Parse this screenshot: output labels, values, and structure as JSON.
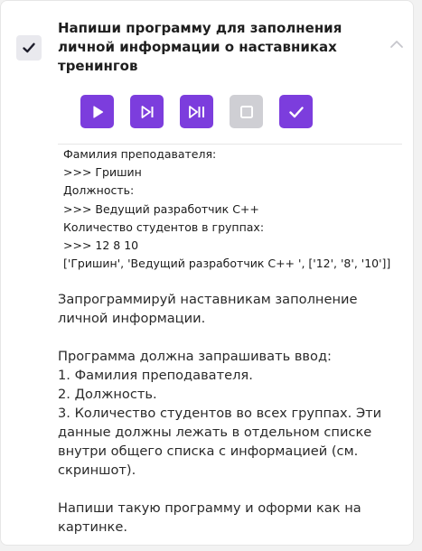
{
  "task": {
    "title": "Напиши программу для заполнения личной информации о наставниках тренингов",
    "completed": true
  },
  "toolbar": {
    "buttons": [
      {
        "icon": "play-icon",
        "state": "active"
      },
      {
        "icon": "step-icon",
        "state": "active"
      },
      {
        "icon": "step-to-end-icon",
        "state": "active"
      },
      {
        "icon": "stop-icon",
        "state": "disabled"
      },
      {
        "icon": "check-icon",
        "state": "active"
      }
    ]
  },
  "console": {
    "lines": [
      "Фамилия преподавателя:",
      ">>> Гришин",
      "Должность:",
      ">>> Ведущий разработчик С++",
      "Количество студентов в группах:",
      ">>> 12 8 10",
      "['Гришин', 'Ведущий разработчик С++ ', ['12', '8', '10']]"
    ]
  },
  "description": {
    "p1": "Запрограммируй наставникам заполнение личной информации.",
    "p2_lines": [
      "Программа должна запрашивать ввод:",
      "1. Фамилия преподавателя.",
      "2. Должность.",
      "3. Количество студентов во всех группах. Эти данные должны лежать в отдельном списке внутри общего списка с информацией (см. скриншот)."
    ],
    "p3": "Напиши такую программу и оформи как на картинке."
  },
  "colors": {
    "accent": "#7c3ddd",
    "disabled": "#cfcfd4"
  }
}
